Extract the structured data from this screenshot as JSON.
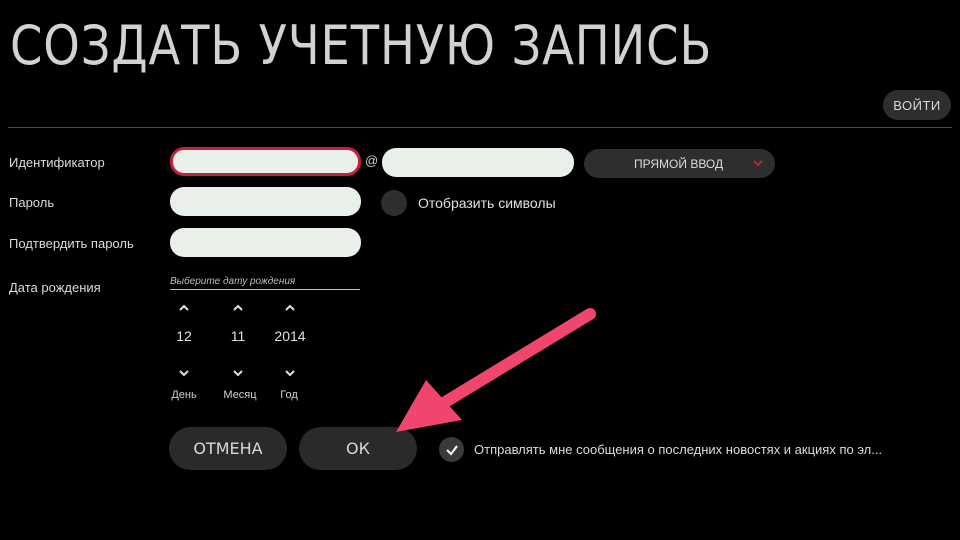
{
  "page": {
    "title": "СОЗДАТЬ УЧЕТНУЮ ЗАПИСЬ"
  },
  "header": {
    "login_label": "ВОЙТИ"
  },
  "form": {
    "id_label": "Идентификатор",
    "id_value": "",
    "at_symbol": "@",
    "domain_value": "",
    "domain_mode": "ПРЯМОЙ ВВОД",
    "password_label": "Пароль",
    "password_value": "",
    "show_chars_label": "Отобразить символы",
    "confirm_label": "Подтвердить пароль",
    "confirm_value": "",
    "birthdate_label": "Дата рождения",
    "birthdate_hint": "Выберите дату рождения",
    "day": {
      "value": "12",
      "label": "День"
    },
    "month": {
      "value": "11",
      "label": "Месяц"
    },
    "year": {
      "value": "2014",
      "label": "Год"
    }
  },
  "actions": {
    "cancel_label": "ОТМЕНА",
    "ok_label": "ОК",
    "newsletter_label": "Отправлять мне сообщения о последних новостях и акциях по эл...",
    "newsletter_checked": true
  },
  "icons": {
    "dropdown": "chevron-down-icon",
    "up": "chevron-up-icon",
    "down": "chevron-down-icon",
    "check": "check-icon",
    "annotation": "pointer-arrow-icon"
  },
  "colors": {
    "accent": "#c2203d",
    "annotation_arrow": "#f0466e",
    "field_bg": "#e9efe9",
    "button_bg": "#2a2a2a"
  }
}
